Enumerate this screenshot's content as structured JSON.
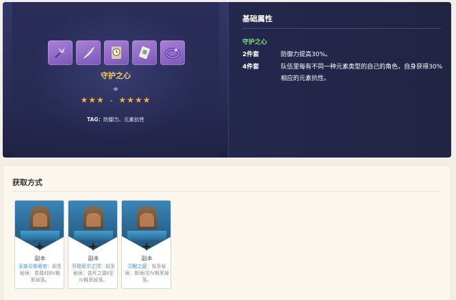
{
  "artifact": {
    "set_name": "守护之心",
    "icons": [
      "flower-icon",
      "feather-icon",
      "clock-icon",
      "goblet-icon",
      "circlet-icon"
    ],
    "stars_low": "★★★",
    "stars_dash": "-",
    "stars_high": "★★★★",
    "tag_label": "TAG：",
    "tag_value": "防御力、元素抗性"
  },
  "attributes": {
    "title": "基础属性",
    "set_name": "守护之心",
    "rows": [
      {
        "key": "2件套",
        "value": "防御力提高30%。"
      },
      {
        "key": "4件套",
        "value": "队伍里每有不同一种元素类型的自己的角色，自身获得30%相应的元素抗性。"
      }
    ]
  },
  "acquisition": {
    "title": "获取方式",
    "cards": [
      {
        "type": "副本",
        "link": "无妄引咎密宫",
        "desc": "：祝圣秘境：意蕴Ⅱ到Ⅳ概率掉落。"
      },
      {
        "type": "副本",
        "link": "芬德尼尔之顶",
        "desc": "：祝圣秘境：告死之霜Ⅱ至Ⅳ概率掉落。"
      },
      {
        "type": "副本",
        "link": "沉眠之庭",
        "desc": "：祝圣秘境：新境Ⅰ至Ⅳ概率掉落。"
      }
    ]
  },
  "colors": {
    "panel_bg": "#24284d",
    "set_name_gold": "#f4cc6a",
    "attr_green": "#7fe07a",
    "star_orange": "#f0b048",
    "link_blue": "#3b8ad6",
    "icon_purple": "#9a72cc"
  }
}
